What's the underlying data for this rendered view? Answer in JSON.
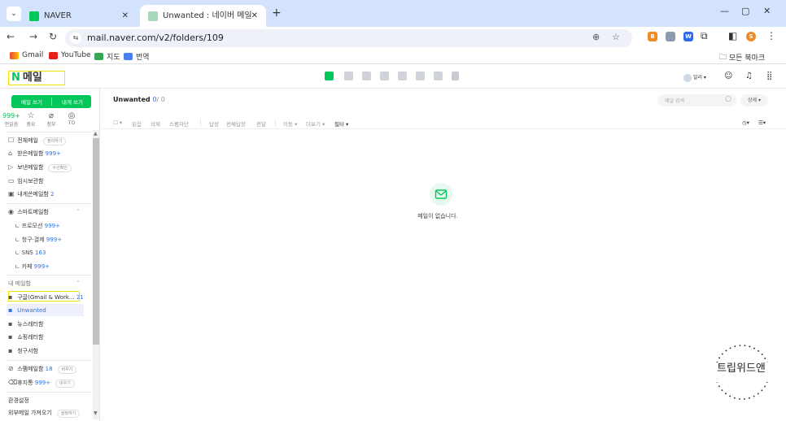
{
  "browser": {
    "tabs": [
      {
        "title": "NAVER",
        "active": false
      },
      {
        "title": "Unwanted : 네이버 메일",
        "active": true
      }
    ],
    "url": "mail.naver.com/v2/folders/109",
    "bookmarks": [
      {
        "label": "Gmail",
        "icon": "gmail-icon"
      },
      {
        "label": "YouTube",
        "icon": "youtube-icon"
      },
      {
        "label": "지도",
        "icon": "map-icon"
      },
      {
        "label": "번역",
        "icon": "papago-icon"
      }
    ],
    "all_bookmarks": "모든 북마크",
    "profile_initial": "S",
    "ext_letters": [
      "B",
      "W"
    ]
  },
  "mail": {
    "logo_n": "N",
    "logo_text": "메일",
    "header_right": {
      "weather": "일리 ▾"
    },
    "compose": {
      "write": "메일 쓰기",
      "to_me": "내게 쓰기"
    },
    "quick": [
      {
        "value": "999+",
        "label": "안읽음"
      },
      {
        "value": "☆",
        "label": "중요"
      },
      {
        "value": "⌀",
        "label": "첨부"
      },
      {
        "value": "◎",
        "label": "TO"
      }
    ],
    "folders": [
      {
        "icon": "☐",
        "name": "전체메일",
        "pill": "정리하기"
      },
      {
        "icon": "⌂",
        "name": "받은메일함",
        "count": "999+"
      },
      {
        "icon": "▷",
        "name": "보낸메일함",
        "pill": "수신확인"
      },
      {
        "icon": "▭",
        "name": "임시보관함"
      },
      {
        "icon": "▣",
        "name": "내게쓴메일함",
        "count": "2"
      }
    ],
    "smart": {
      "title": "스마트메일함",
      "items": [
        {
          "name": "프로모션",
          "count": "999+"
        },
        {
          "name": "청구·결제",
          "count": "999+"
        },
        {
          "name": "SNS",
          "count": "163"
        },
        {
          "name": "카페",
          "count": "999+"
        }
      ]
    },
    "my_folders": {
      "title": "내 메일함",
      "items": [
        {
          "name": "구글(Gmail & Work...",
          "count": "21"
        },
        {
          "name": "Unwanted"
        },
        {
          "name": "뉴스레터함"
        },
        {
          "name": "쇼핑레터함"
        },
        {
          "name": "청구서함"
        }
      ]
    },
    "bottom_folders": [
      {
        "icon": "⊘",
        "name": "스팸메일함",
        "count": "18",
        "pill": "비우기"
      },
      {
        "icon": "🗑",
        "name": "휴지통",
        "count": "999+",
        "pill": "비우기"
      }
    ],
    "settings": "환경설정",
    "fetch": {
      "label": "외부메일 가져오기",
      "pill": "설정하기"
    },
    "list": {
      "title": "Unwanted",
      "unread": "0",
      "total": "/ 0",
      "search_placeholder": "메일 검색",
      "detail": "상세 ▾"
    },
    "actions": [
      "읽음",
      "삭제",
      "스팸차단",
      "답장",
      "전체답장",
      "전달",
      "이동 ▾",
      "더보기 ▾",
      "필터 ▾"
    ],
    "empty_message": "메일이 없습니다."
  },
  "watermark": "트립위드앤",
  "colors": {
    "naver_green": "#03c75a",
    "count_blue": "#2d74ea",
    "highlight": "#f2e600"
  }
}
